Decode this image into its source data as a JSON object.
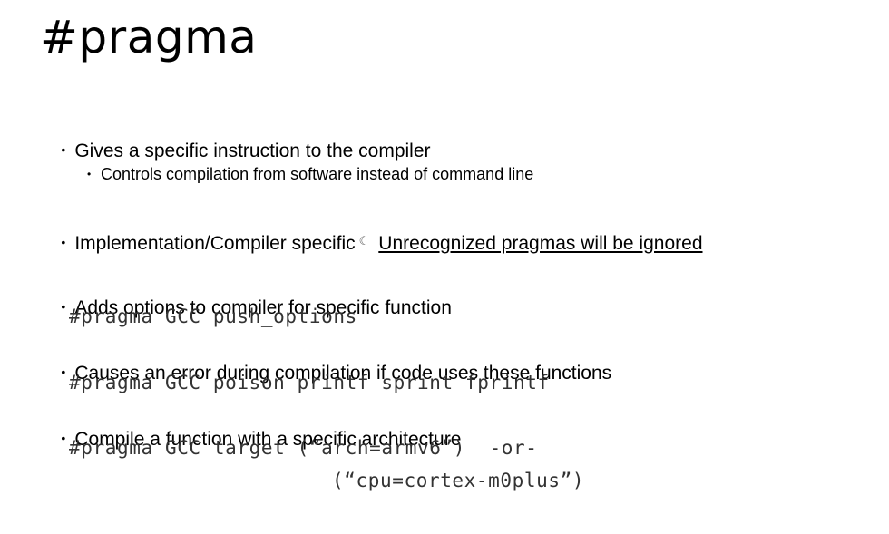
{
  "slide": {
    "title": "#pragma",
    "bullets": [
      {
        "text": "Gives a specific instruction to the compiler"
      },
      {
        "text": "Controls compilation from software instead of command line"
      },
      {
        "text": "Implementation/Compiler specific",
        "arrow": "☾",
        "emphasis": "Unrecognized pragmas will be ignored"
      },
      {
        "text": "Adds options to compiler for specific function"
      },
      {
        "code": "#pragma GCC push_options"
      },
      {
        "text": "Causes an error during compilation if code uses these functions"
      },
      {
        "code": "#pragma GCC poison printf sprint fprintf"
      },
      {
        "text": "Compile a function with a specific architecture"
      },
      {
        "code": "#pragma GCC target (“arch=armv6”)  -or-"
      },
      {
        "code": "(“cpu=cortex-m0plus”)"
      }
    ],
    "bullet_glyph": "•"
  }
}
